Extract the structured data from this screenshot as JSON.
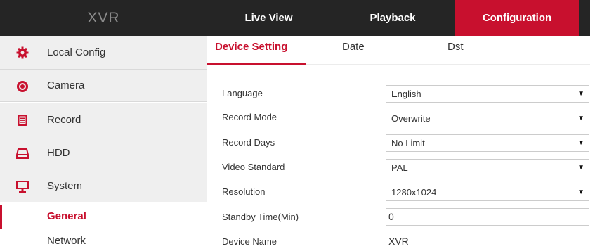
{
  "app": {
    "title": "XVR"
  },
  "nav": {
    "tabs": [
      {
        "label": "Live View",
        "active": false
      },
      {
        "label": "Playback",
        "active": false
      },
      {
        "label": "Configuration",
        "active": true
      }
    ]
  },
  "sidebar": {
    "items": [
      {
        "label": "Local Config",
        "icon": "gear-icon"
      },
      {
        "label": "Camera",
        "icon": "camera-lens-icon"
      },
      {
        "label": "Record",
        "icon": "record-icon"
      },
      {
        "label": "HDD",
        "icon": "hdd-icon"
      },
      {
        "label": "System",
        "icon": "monitor-icon"
      }
    ],
    "subitems": [
      {
        "label": "General",
        "active": true
      },
      {
        "label": "Network",
        "active": false
      }
    ]
  },
  "subtabs": [
    {
      "label": "Device Setting",
      "active": true
    },
    {
      "label": "Date",
      "active": false
    },
    {
      "label": "Dst",
      "active": false
    }
  ],
  "form": {
    "rows": [
      {
        "label": "Language",
        "value": "English",
        "type": "select"
      },
      {
        "label": "Record Mode",
        "value": "Overwrite",
        "type": "select"
      },
      {
        "label": "Record Days",
        "value": "No Limit",
        "type": "select"
      },
      {
        "label": "Video Standard",
        "value": "PAL",
        "type": "select"
      },
      {
        "label": "Resolution",
        "value": "1280x1024",
        "type": "select"
      },
      {
        "label": "Standby Time(Min)",
        "value": "0",
        "type": "input"
      },
      {
        "label": "Device Name",
        "value": "XVR",
        "type": "input"
      }
    ]
  },
  "colors": {
    "accent": "#c8102e",
    "topbar": "#252525",
    "sidebar_bg": "#efefef"
  }
}
